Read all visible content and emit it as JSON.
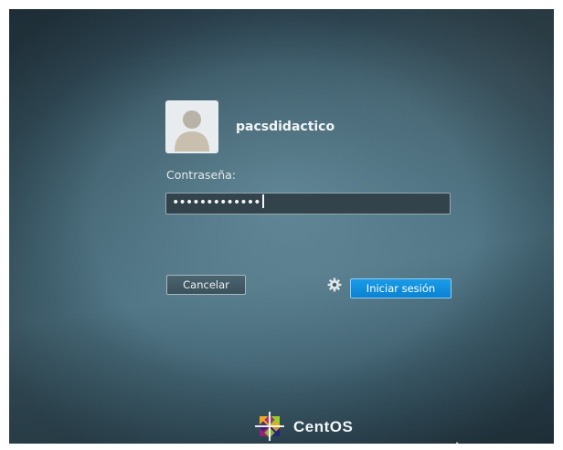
{
  "login": {
    "username": "pacsdidactico",
    "password_label": "Contraseña:",
    "password_masked": "•••••••••••••",
    "cancel_label": "Cancelar",
    "submit_label": "Iniciar sesión"
  },
  "branding": {
    "name": "CentOS"
  },
  "icons": {
    "avatar": "user-avatar-icon",
    "session": "gear-icon",
    "logo": "centos-logo-icon",
    "pointer": "mouse-pointer-icon"
  },
  "colors": {
    "accent": "#0a82d2",
    "background": "#3e5e6c"
  }
}
